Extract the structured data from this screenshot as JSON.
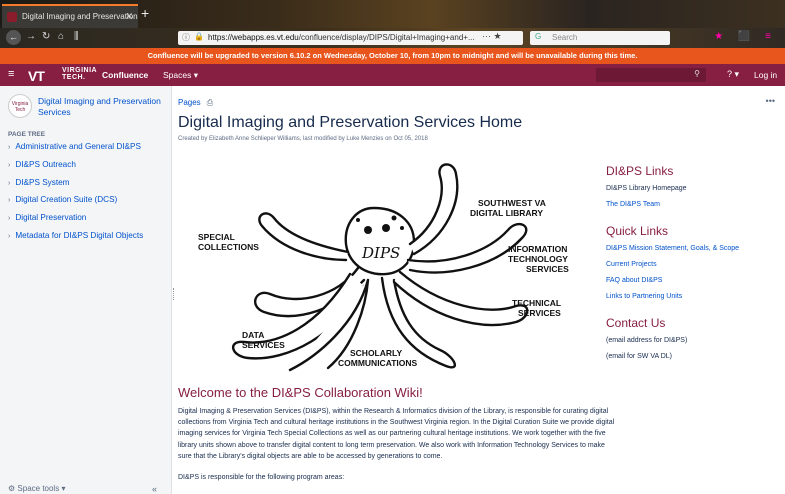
{
  "browser": {
    "tab_title": "Digital Imaging and Preservation",
    "url_host": "https://webapps.es.vt.edu",
    "url_path": "/confluence/display/DIPS/Digital+Imaging+and+...",
    "search_placeholder": "Search"
  },
  "banner": {
    "text": "Confluence will be upgraded to version 6.10.2 on Wednesday, October 10, from 10pm to midnight and will be unavailable during this time."
  },
  "header": {
    "university_line1": "VIRGINIA",
    "university_line2": "TECH.",
    "app_name": "Confluence",
    "spaces_label": "Spaces",
    "help_label": "?",
    "login_label": "Log in"
  },
  "sidebar": {
    "space_logo_text": "Virginia Tech",
    "space_name": "Digital Imaging and Preservation Services",
    "tree_heading": "PAGE TREE",
    "items": [
      {
        "label": "Administrative and General DI&PS"
      },
      {
        "label": "DI&PS Outreach"
      },
      {
        "label": "DI&PS System"
      },
      {
        "label": "Digital Creation Suite (DCS)"
      },
      {
        "label": "Digital Preservation"
      },
      {
        "label": "Metadata for DI&PS Digital Objects"
      }
    ],
    "space_tools_label": "Space tools",
    "collapse_label": "«"
  },
  "page": {
    "breadcrumb": "Pages",
    "title": "Digital Imaging and Preservation Services Home",
    "byline": "Created by Elizabeth Anne Schlieper Williams, last modified by Luke Menzies on Oct 05, 2018",
    "welcome_heading": "Welcome to the DI&PS Collaboration Wiki!",
    "intro_paragraph": "Digital Imaging & Preservation Services (DI&PS), within the Research & Informatics division of the Library, is responsible for curating digital collections from Virginia Tech and cultural heritage institutions in the Southwest Virginia region. In the Digital Curation Suite we provide digital imaging services for Virginia Tech Special Collections as well as our partnering cultural heritage institutions. We work together with the five library units shown above to transfer digital content to long term preservation. We also work with Information Technology Services to make sure that the Library's digital objects are able to be accessed by generations to come.",
    "program_areas_line": "DI&PS is responsible for the following program areas:"
  },
  "illustration": {
    "mascot_label": "DIPS",
    "labels": {
      "southwest_1": "SOUTHWEST VA",
      "southwest_2": "DIGITAL LIBRARY",
      "special_1": "SPECIAL",
      "special_2": "COLLECTIONS",
      "info_1": "INFORMATION",
      "info_2": "TECHNOLOGY",
      "info_3": "SERVICES",
      "tech_1": "TECHNICAL",
      "tech_2": "SERVICES",
      "data_1": "DATA",
      "data_2": "SERVICES",
      "schol_1": "SCHOLARLY",
      "schol_2": "COMMUNICATIONS"
    }
  },
  "right_sidebar": {
    "links_heading": "DI&PS Links",
    "links": [
      {
        "label": "DI&PS Library Homepage",
        "link": false
      },
      {
        "label": "The DI&PS Team",
        "link": true
      }
    ],
    "quick_heading": "Quick Links",
    "quick_links": [
      {
        "label": "DI&PS Mission Statement, Goals, & Scope"
      },
      {
        "label": "Current Projects"
      },
      {
        "label": "FAQ about DI&PS"
      },
      {
        "label": "Links to Partnering Units"
      }
    ],
    "contact_heading": "Contact Us",
    "contact_lines": [
      {
        "label": "(email address for DI&PS)"
      },
      {
        "label": "(email for SW VA DL)"
      }
    ]
  },
  "colors": {
    "brand_maroon": "#861f41",
    "banner_orange": "#e8561e",
    "link_blue": "#0052cc"
  }
}
